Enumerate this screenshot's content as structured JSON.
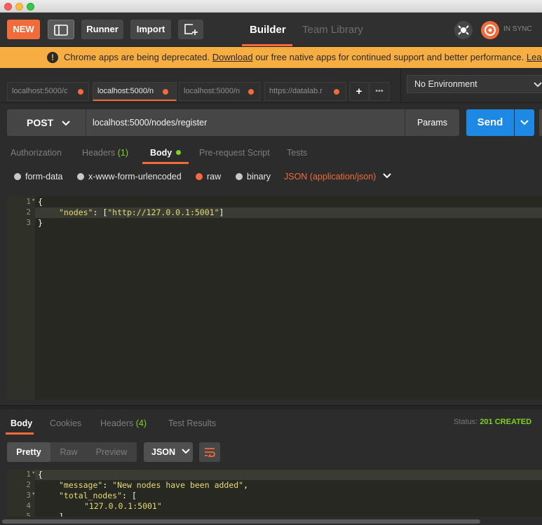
{
  "header": {
    "new_label": "NEW",
    "runner_label": "Runner",
    "import_label": "Import",
    "builder_tab": "Builder",
    "team_library_tab": "Team Library",
    "sync_status": "IN SYNC"
  },
  "banner": {
    "text_before": "Chrome apps are being deprecated.",
    "link_download": "Download",
    "text_after": "our free native apps for continued support and better performance.",
    "link_learn_more": "Learn mo"
  },
  "request_tabs": [
    {
      "label": "localhost:5000/c"
    },
    {
      "label": "localhost:5000/n"
    },
    {
      "label": "localhost:5000/n"
    },
    {
      "label": "https://datalab.r"
    }
  ],
  "environment": {
    "selected": "No Environment"
  },
  "request": {
    "method": "POST",
    "url": "localhost:5000/nodes/register",
    "params_label": "Params",
    "send_label": "Send"
  },
  "request_subtabs": {
    "authorization": "Authorization",
    "headers": "Headers",
    "headers_count": "(1)",
    "body": "Body",
    "prerequest": "Pre-request Script",
    "tests": "Tests"
  },
  "body_modes": {
    "form_data": "form-data",
    "urlencoded": "x-www-form-urlencoded",
    "raw": "raw",
    "binary": "binary",
    "content_type": "JSON (application/json)",
    "selected": "raw"
  },
  "request_body": {
    "line_numbers": [
      "1",
      "2",
      "3"
    ],
    "line1": "{",
    "line2_key": "\"nodes\"",
    "line2_sep": ": [",
    "line2_value": "\"http://127.0.0.1:5001\"",
    "line2_end": "]",
    "line3": "}"
  },
  "response": {
    "tabs": {
      "body": "Body",
      "cookies": "Cookies",
      "headers": "Headers",
      "headers_count": "(4)",
      "test_results": "Test Results"
    },
    "status_label": "Status:",
    "status_value": "201 CREATED",
    "formats": {
      "pretty": "Pretty",
      "raw": "Raw",
      "preview": "Preview",
      "language": "JSON"
    },
    "line_numbers": [
      "1",
      "2",
      "3",
      "4",
      "5"
    ],
    "line1": "{",
    "line2_key": "\"message\"",
    "line2_value": "\"New nodes have been added\"",
    "line3_key": "\"total_nodes\"",
    "line3_sep": ": [",
    "line4_value": "\"127.0.0.1:5001\"",
    "line5": "]"
  },
  "colors": {
    "accent": "#f26b3a",
    "send_blue": "#1e88e5",
    "banner": "#f6ad42",
    "status_green": "#7ed321",
    "editor_bg": "#272822"
  }
}
